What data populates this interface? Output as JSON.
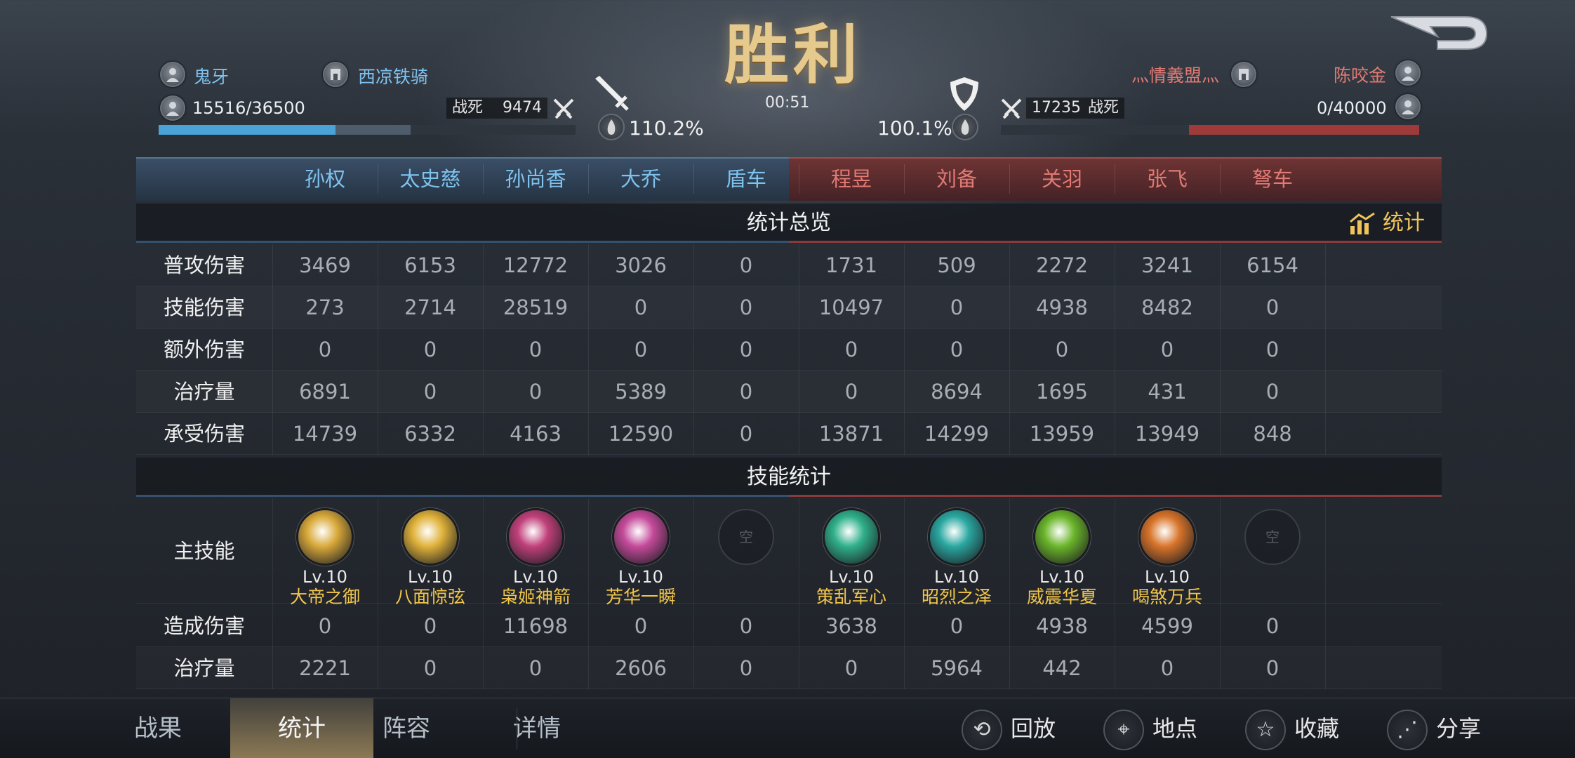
{
  "header": {
    "result": "胜利",
    "timer": "00:51",
    "left": {
      "player": "鬼牙",
      "guild": "西凉铁骑",
      "hp": "15516/36500",
      "kd_label": "战死",
      "kd_value": "9474",
      "pct": "110.2%",
      "hp_fraction": 0.425,
      "dmg_fraction": 0.605
    },
    "right": {
      "player": "陈咬金",
      "guild": "灬情義盟灬",
      "hp": "0/40000",
      "kd_label": "战死",
      "kd_value": "17235",
      "pct": "100.1%",
      "dmg_fraction": 0.55
    }
  },
  "columns": {
    "left": [
      "孙权",
      "太史慈",
      "孙尚香",
      "大乔",
      "盾车"
    ],
    "right": [
      "程昱",
      "刘备",
      "关羽",
      "张飞",
      "弩车"
    ]
  },
  "overview": {
    "title": "统计总览",
    "stat_button": "统计",
    "rows": [
      {
        "label": "普攻伤害",
        "values": [
          "3469",
          "6153",
          "12772",
          "3026",
          "0",
          "1731",
          "509",
          "2272",
          "3241",
          "6154"
        ]
      },
      {
        "label": "技能伤害",
        "values": [
          "273",
          "2714",
          "28519",
          "0",
          "0",
          "10497",
          "0",
          "4938",
          "8482",
          "0"
        ]
      },
      {
        "label": "额外伤害",
        "values": [
          "0",
          "0",
          "0",
          "0",
          "0",
          "0",
          "0",
          "0",
          "0",
          "0"
        ]
      },
      {
        "label": "治疗量",
        "values": [
          "6891",
          "0",
          "0",
          "5389",
          "0",
          "0",
          "8694",
          "1695",
          "431",
          "0"
        ]
      },
      {
        "label": "承受伤害",
        "values": [
          "14739",
          "6332",
          "4163",
          "12590",
          "0",
          "13871",
          "14299",
          "13959",
          "13949",
          "848"
        ]
      }
    ]
  },
  "skills": {
    "title": "技能统计",
    "main_label": "主技能",
    "empty_label": "空",
    "list": [
      {
        "level": "Lv.10",
        "name": "大帝之御",
        "color": "#d9a93a"
      },
      {
        "level": "Lv.10",
        "name": "八面惊弦",
        "color": "#e0b23a"
      },
      {
        "level": "Lv.10",
        "name": "枭姬神箭",
        "color": "#c0407a"
      },
      {
        "level": "Lv.10",
        "name": "芳华一瞬",
        "color": "#c44a9a"
      },
      null,
      {
        "level": "Lv.10",
        "name": "策乱军心",
        "color": "#2fb08a"
      },
      {
        "level": "Lv.10",
        "name": "昭烈之泽",
        "color": "#2aa7a0"
      },
      {
        "level": "Lv.10",
        "name": "威震华夏",
        "color": "#6ab52a"
      },
      {
        "level": "Lv.10",
        "name": "喝煞万兵",
        "color": "#d8742a"
      },
      null
    ],
    "rows": [
      {
        "label": "造成伤害",
        "values": [
          "0",
          "0",
          "11698",
          "0",
          "0",
          "3638",
          "0",
          "4938",
          "4599",
          "0"
        ]
      },
      {
        "label": "治疗量",
        "values": [
          "2221",
          "0",
          "0",
          "2606",
          "0",
          "0",
          "5964",
          "442",
          "0",
          "0"
        ]
      }
    ]
  },
  "bottom": {
    "tabs": [
      "战果",
      "统计",
      "阵容",
      "详情"
    ],
    "active_tab": "统计",
    "actions": [
      "回放",
      "地点",
      "收藏",
      "分享"
    ]
  },
  "colors": {
    "left_team": "#7ec2ee",
    "right_team": "#e07a73",
    "skill_name": "#f2c64a",
    "hp_left": "#4aa3d6",
    "hp_right": "#9e3a3a"
  }
}
